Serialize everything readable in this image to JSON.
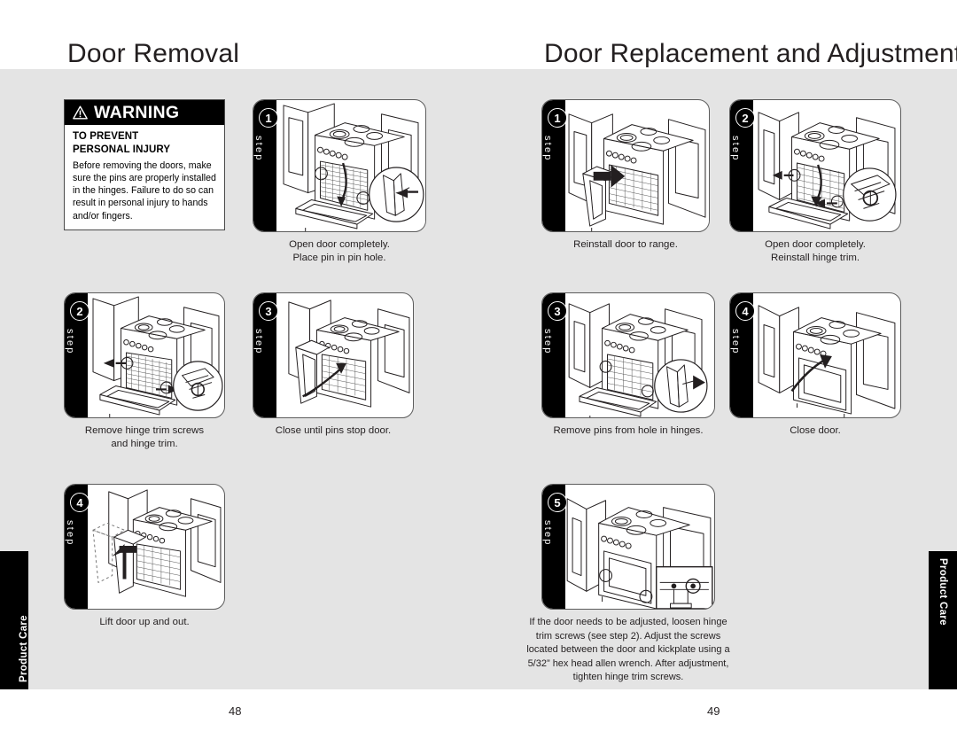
{
  "spread": {
    "left_page": {
      "header": "Door Removal",
      "page_number": "48",
      "side_tab": "Product Care",
      "warning": {
        "heading": "WARNING",
        "subheading_line1": "TO PREVENT",
        "subheading_line2": "PERSONAL INJURY",
        "body": "Before removing the doors, make sure the pins are properly installed in the hinges. Failure to do so can result in personal injury to hands and/or fingers.",
        "icon": "warning-triangle-icon"
      },
      "steps": [
        {
          "number": "1",
          "label": "step",
          "caption": "Open door completely.\nPlace pin in pin hole.",
          "art": "range-door-open-pin-detail"
        },
        {
          "number": "2",
          "label": "step",
          "caption": "Remove hinge trim screws\nand hinge trim.",
          "art": "range-door-open-screw-detail"
        },
        {
          "number": "3",
          "label": "step",
          "caption": "Close until pins stop door.",
          "art": "range-door-closing-arrow"
        },
        {
          "number": "4",
          "label": "step",
          "caption": "Lift door up and out.",
          "art": "range-door-lift-out"
        }
      ]
    },
    "right_page": {
      "header": "Door Replacement and Adjustment",
      "page_number": "49",
      "side_tab": "Product Care",
      "steps": [
        {
          "number": "1",
          "label": "step",
          "caption": "Reinstall door to range.",
          "art": "range-door-reinstall"
        },
        {
          "number": "2",
          "label": "step",
          "caption": "Open door completely.\nReinstall hinge trim.",
          "art": "range-door-open-hinge-trim-detail"
        },
        {
          "number": "3",
          "label": "step",
          "caption": "Remove pins from hole in hinges.",
          "art": "range-door-open-pin-remove-detail"
        },
        {
          "number": "4",
          "label": "step",
          "caption": "Close door.",
          "art": "range-door-close"
        },
        {
          "number": "5",
          "label": "step",
          "caption": "If the door needs to be adjusted, loosen hinge trim screws (see step 2). Adjust the screws located between the door and kickplate using a 5/32” hex head allen wrench. After adjustment, tighten hinge trim screws.",
          "art": "range-closed-adjust-screw-callout"
        }
      ]
    }
  },
  "colors": {
    "page_background": "#ffffff",
    "content_background": "#e4e4e4",
    "ink": "#231f20",
    "bar_black": "#000000",
    "panel_border": "#5c5c5c"
  }
}
